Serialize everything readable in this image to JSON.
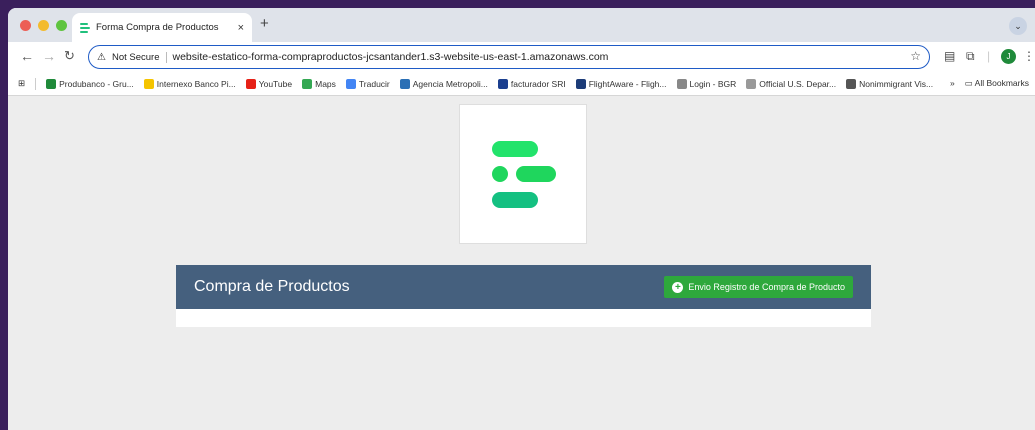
{
  "browser": {
    "tab_title": "Forma Compra de Productos",
    "tab_close": "×",
    "new_tab": "+",
    "tab_menu": "⌄",
    "not_secure": "Not Secure",
    "url": "website-estatico-forma-compraproductos-jcsantander1.s3-website-us-east-1.amazonaws.com",
    "avatar_initial": "J"
  },
  "bookmarks": {
    "items": [
      {
        "label": "Produbanco - Gru...",
        "color": "#1f8a3a"
      },
      {
        "label": "Internexo Banco Pi...",
        "color": "#f5c400"
      },
      {
        "label": "YouTube",
        "color": "#e62117"
      },
      {
        "label": "Maps",
        "color": "#34a853"
      },
      {
        "label": "Traducir",
        "color": "#4285f4"
      },
      {
        "label": "Agencia Metropoli...",
        "color": "#2a6fb5"
      },
      {
        "label": "facturador SRI",
        "color": "#1b3f8f"
      },
      {
        "label": "FlightAware - Fligh...",
        "color": "#1d3c78"
      },
      {
        "label": "Login - BGR",
        "color": "#888888"
      },
      {
        "label": "Official U.S. Depar...",
        "color": "#999999"
      },
      {
        "label": "Nonimmigrant Vis...",
        "color": "#555555"
      }
    ],
    "overflow": "»",
    "all_bookmarks": "All Bookmarks"
  },
  "logo": {
    "colors": {
      "top": "#22e36b",
      "mid": "#1fd65d",
      "bottom": "#14c081"
    }
  },
  "panel": {
    "title": "Compra de Productos",
    "button_label": "Envio Registro de Compra de Producto",
    "header_color": "#45607e",
    "button_color": "#2ea83c"
  }
}
